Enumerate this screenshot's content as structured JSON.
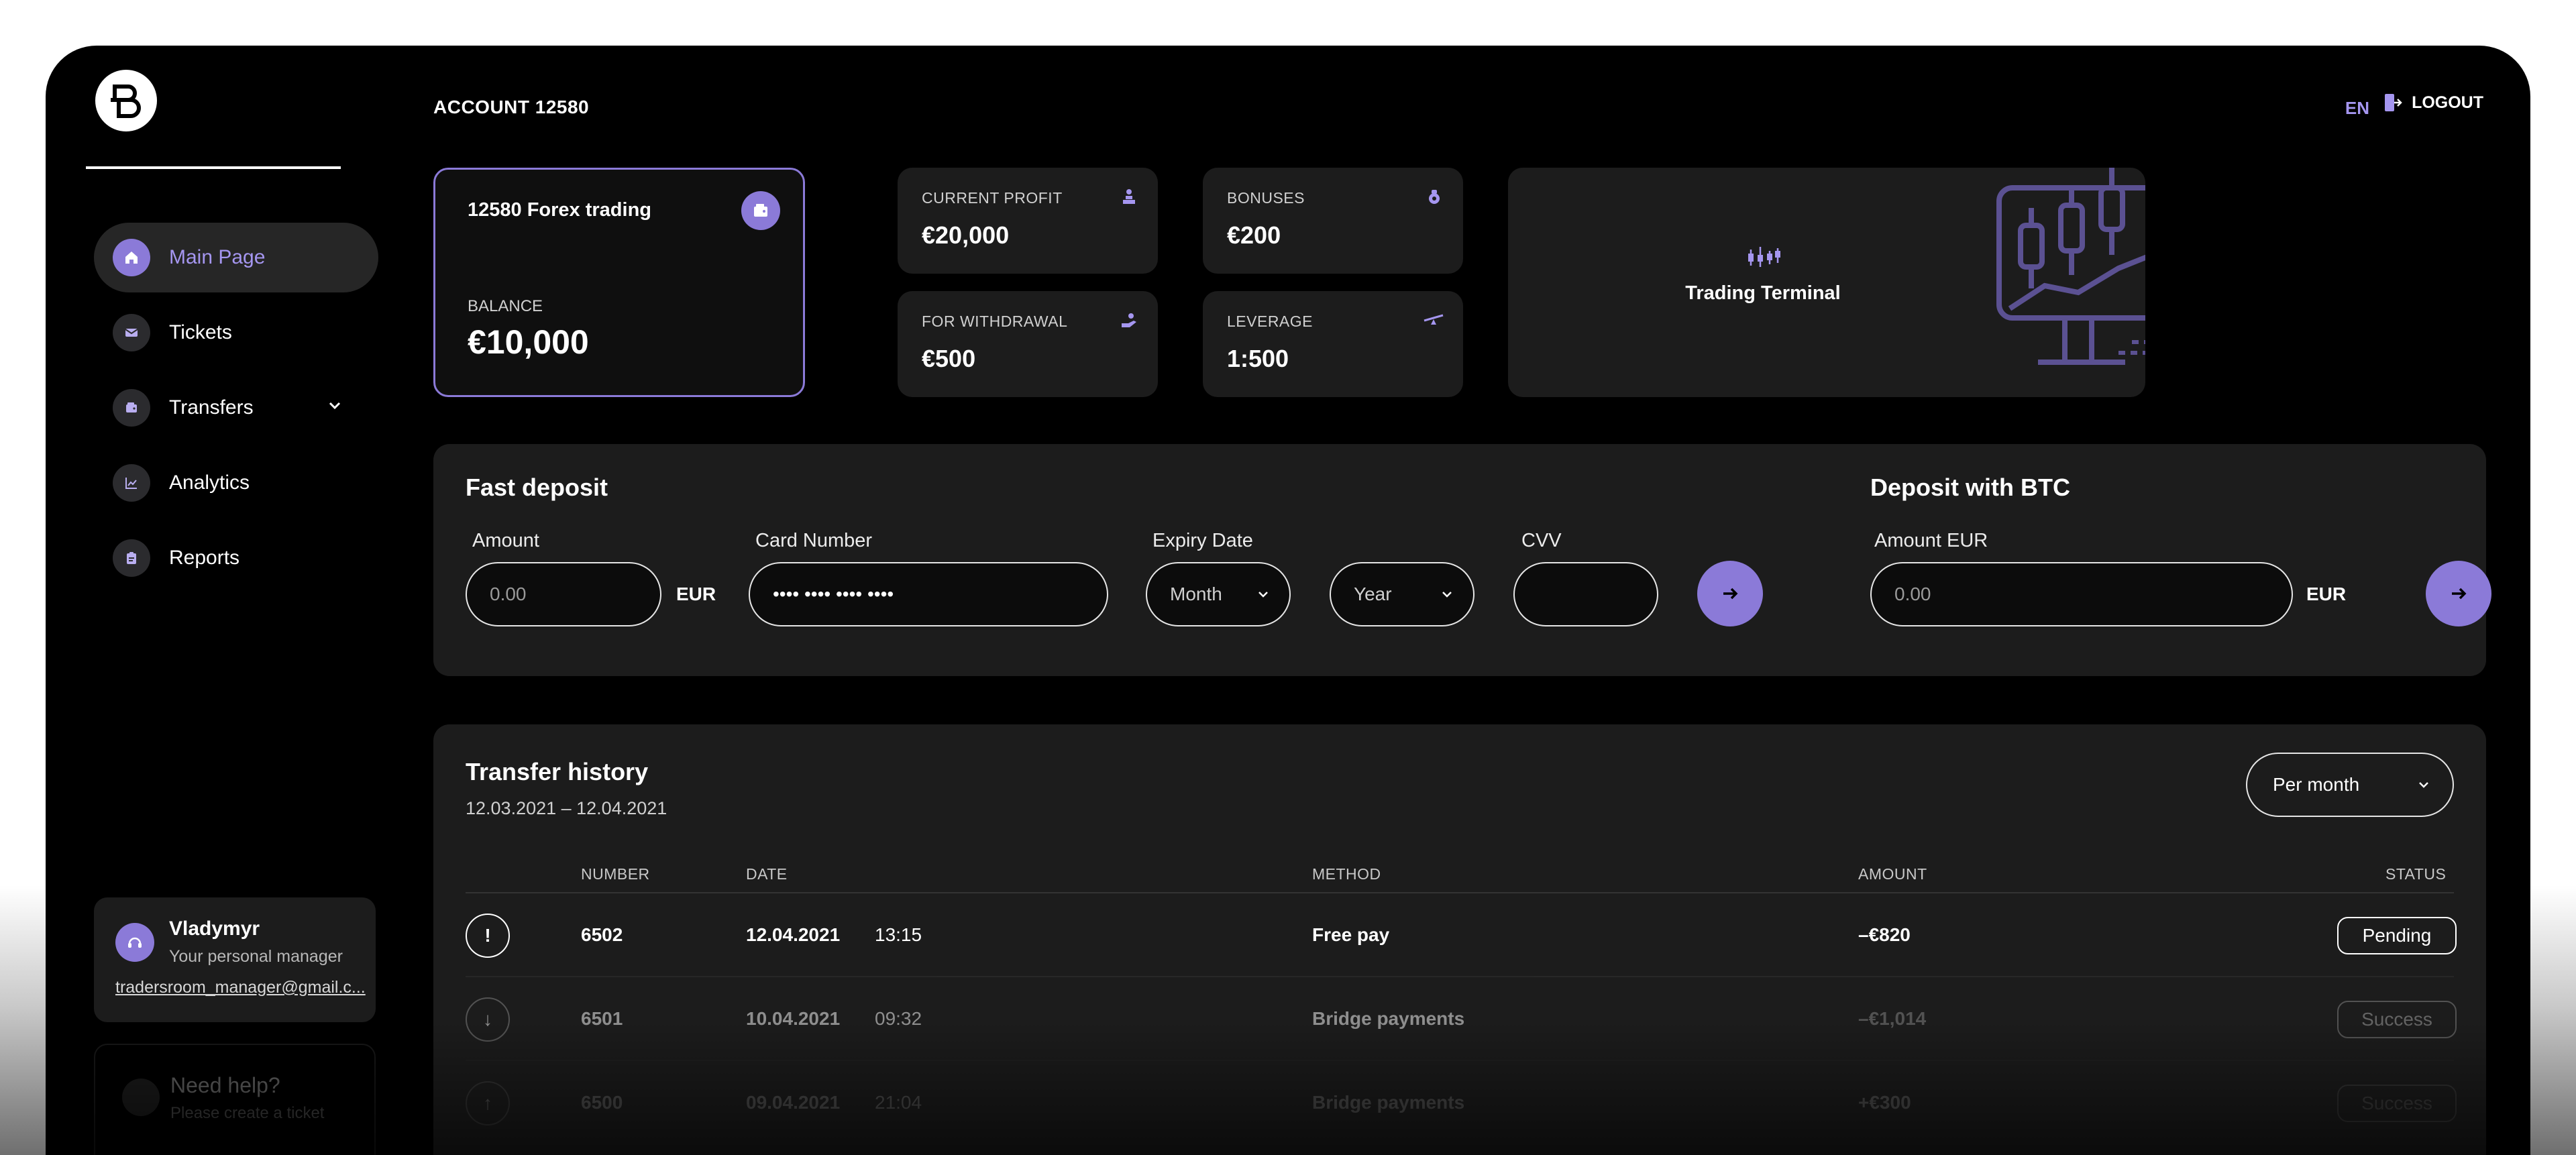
{
  "header": {
    "account_title": "ACCOUNT 12580",
    "language": "EN",
    "logout_label": "LOGOUT"
  },
  "sidebar": {
    "items": [
      {
        "label": "Main Page",
        "icon": "home-icon",
        "active": true
      },
      {
        "label": "Tickets",
        "icon": "envelope-icon"
      },
      {
        "label": "Transfers",
        "icon": "wallet-icon",
        "expandable": true
      },
      {
        "label": "Analytics",
        "icon": "chart-icon"
      },
      {
        "label": "Reports",
        "icon": "clipboard-icon"
      }
    ],
    "manager": {
      "name": "Vladymyr",
      "subtitle": "Your personal manager",
      "email": "tradersroom_manager@gmail.c..."
    },
    "help": {
      "title": "Need help?",
      "subtitle": "Please create a ticket"
    }
  },
  "balance_card": {
    "name": "12580 Forex trading",
    "label": "BALANCE",
    "value": "€10,000"
  },
  "stats": {
    "current_profit": {
      "label": "CURRENT PROFIT",
      "value": "€20,000"
    },
    "bonuses": {
      "label": "BONUSES",
      "value": "€200"
    },
    "withdrawal": {
      "label": "FOR WITHDRAWAL",
      "value": "€500"
    },
    "leverage": {
      "label": "LEVERAGE",
      "value": "1:500"
    }
  },
  "terminal": {
    "label": "Trading Terminal"
  },
  "fast_deposit": {
    "title": "Fast deposit",
    "amount_label": "Amount",
    "amount_placeholder": "0.00",
    "currency": "EUR",
    "card_label": "Card Number",
    "card_placeholder": "•••• •••• •••• ••••",
    "expiry_label": "Expiry Date",
    "month": "Month",
    "year": "Year",
    "cvv_label": "CVV"
  },
  "btc_deposit": {
    "title": "Deposit with BTC",
    "amount_label": "Amount EUR",
    "amount_placeholder": "0.00",
    "currency": "EUR"
  },
  "history": {
    "title": "Transfer history",
    "range": "12.03.2021 – 12.04.2021",
    "period": "Per month",
    "columns": {
      "number": "NUMBER",
      "date": "DATE",
      "method": "METHOD",
      "amount": "AMOUNT",
      "status": "STATUS"
    },
    "rows": [
      {
        "icon": "!",
        "number": "6502",
        "date": "12.04.2021",
        "time": "13:15",
        "method": "Free pay",
        "amount": "–€820",
        "status": "Pending"
      },
      {
        "icon": "↓",
        "number": "6501",
        "date": "10.04.2021",
        "time": "09:32",
        "method": "Bridge payments",
        "amount": "–€1,014",
        "status": "Success"
      },
      {
        "icon": "↑",
        "number": "6500",
        "date": "09.04.2021",
        "time": "21:04",
        "method": "Bridge payments",
        "amount": "+€300",
        "status": "Success"
      }
    ]
  },
  "colors": {
    "accent": "#8b7ad8",
    "accent_text": "#a596f0",
    "card_bg": "#1c1c1c",
    "page_bg": "#000000"
  }
}
